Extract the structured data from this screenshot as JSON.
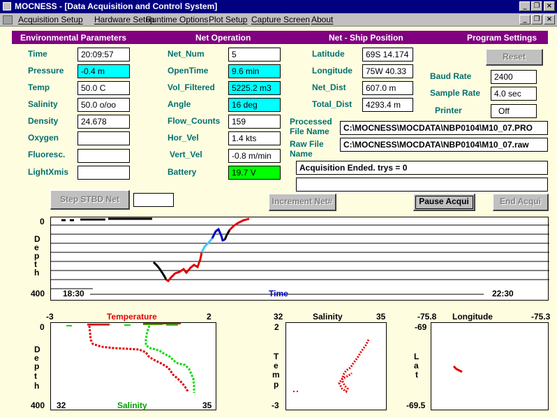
{
  "window": {
    "title": "MOCNESS - [Data Acquisition and Control System]"
  },
  "menu": [
    "Acquisition Setup",
    "Hardware Setup",
    "Runtime Options",
    "Plot Setup",
    "Capture Screen",
    "About"
  ],
  "sections": {
    "env": "Environmental Parameters",
    "net": "Net Operation",
    "pos": "Net - Ship Position",
    "settings": "Program Settings"
  },
  "env": [
    {
      "label": "Time",
      "value": "20:09:57"
    },
    {
      "label": "Pressure",
      "value": "-0.4 m"
    },
    {
      "label": "Temp",
      "value": "50.0 C"
    },
    {
      "label": "Salinity",
      "value": "50.0 o/oo"
    },
    {
      "label": "Density",
      "value": "24.678"
    },
    {
      "label": "Oxygen",
      "value": ""
    },
    {
      "label": "Fluoresc.",
      "value": ""
    },
    {
      "label": "LightXmis",
      "value": ""
    }
  ],
  "net": [
    {
      "label": "Net_Num",
      "value": "5"
    },
    {
      "label": "OpenTime",
      "value": "9.6 min"
    },
    {
      "label": "Vol_Filtered",
      "value": "5225.2 m3"
    },
    {
      "label": "Angle",
      "value": "16 deg"
    },
    {
      "label": "Flow_Counts",
      "value": "159"
    },
    {
      "label": "Hor_Vel",
      "value": "1.4 kts"
    },
    {
      "label": "Vert_Vel",
      "value": "-0.8 m/min"
    },
    {
      "label": "Battery",
      "value": "19.7 V"
    }
  ],
  "pos": [
    {
      "label": "Latitude",
      "value": "69S 14.174"
    },
    {
      "label": "Longitude",
      "value": "75W 40.33"
    },
    {
      "label": "Net_Dist",
      "value": "607.0 m"
    },
    {
      "label": "Total_Dist",
      "value": "4293.4 m"
    }
  ],
  "settings": {
    "reset": "Reset",
    "baud_label": "Baud Rate",
    "baud": "2400",
    "sample_label": "Sample Rate",
    "sample": "4.0 sec",
    "printer_label": "Printer",
    "printer": "Off"
  },
  "files": {
    "processed_label_1": "Processed",
    "processed_label_2": "File Name",
    "processed": "C:\\MOCNESS\\MOCDATA\\NBP0104\\M10_07.PRO",
    "raw_label_1": "Raw File",
    "raw_label_2": "Name",
    "raw": "C:\\MOCNESS\\MOCDATA\\NBP0104\\M10_07.raw"
  },
  "status": {
    "message": "Acquisition Ended. trys = 0",
    "message2": ""
  },
  "buttons": {
    "step": "Step STBD Net",
    "step_field": "",
    "increment": "Increment Net#",
    "pause": "Pause Acqui",
    "end": "End Acqui"
  },
  "depth_time_plot": {
    "y_top": "0",
    "y_bottom": "400",
    "y_axis": [
      "D",
      "e",
      "p",
      "t",
      "h"
    ],
    "x_start": "18:30",
    "x_end": "22:30",
    "x_label": "Time"
  },
  "profile_plot": {
    "temp_min": "-3",
    "temp_label": "Temperature",
    "temp_max": "2",
    "depth_top": "0",
    "depth_bottom": "400",
    "y_axis": [
      "D",
      "e",
      "p",
      "t",
      "h"
    ],
    "sal_min": "32",
    "sal_label": "Salinity",
    "sal_max": "35"
  },
  "ts_plot": {
    "x_min": "32",
    "x_label": "Salinity",
    "x_max": "35",
    "y_top": "2",
    "y_bottom": "-3",
    "y_axis": [
      "T",
      "e",
      "m",
      "p"
    ]
  },
  "latlon_plot": {
    "x_min": "-75.8",
    "x_label": "Longitude",
    "x_max": "-75.3",
    "y_top": "-69",
    "y_bottom": "-69.5",
    "y_axis": [
      "L",
      "a",
      "t"
    ]
  },
  "colors": {
    "title_bar": "#000080",
    "section_bar": "#800080",
    "label": "#007070",
    "cyan_field": "#00ffff",
    "battery": "#00ff00",
    "temperature": "#e00000",
    "salinity": "#00dd00",
    "descent": "#0000c0",
    "ascent": "#40c8ff"
  }
}
